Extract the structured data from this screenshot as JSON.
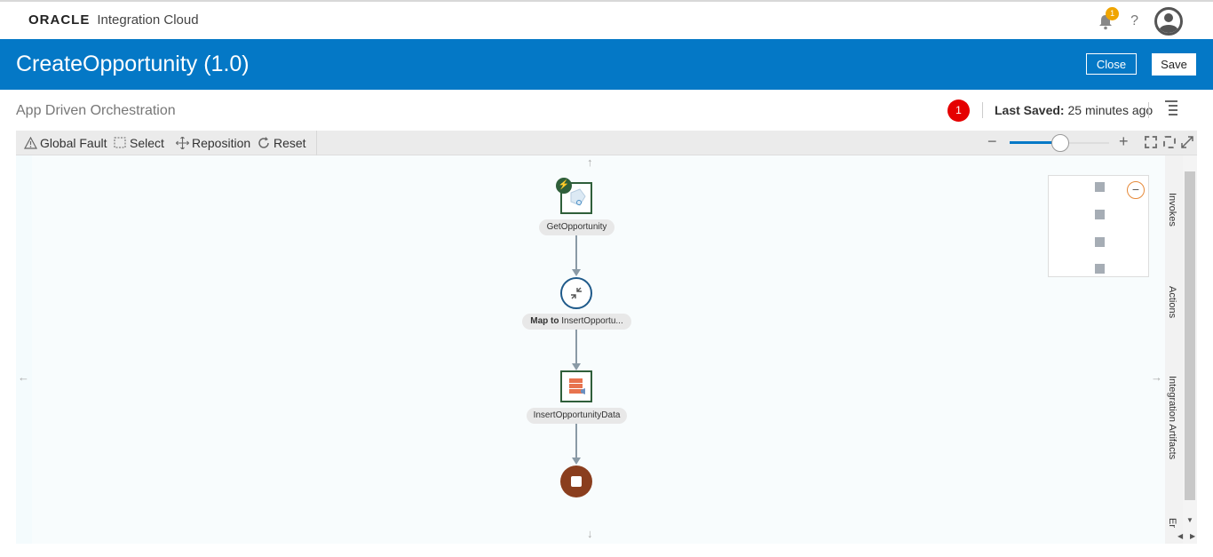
{
  "header": {
    "brand": "ORACLE",
    "product": "Integration Cloud",
    "notification_count": "1",
    "help_symbol": "?"
  },
  "titlebar": {
    "title": "CreateOpportunity (1.0)",
    "close_label": "Close",
    "save_label": "Save"
  },
  "subbar": {
    "subtitle": "App Driven Orchestration",
    "error_count": "1",
    "last_saved_label": "Last Saved:",
    "last_saved_value": "25 minutes ago"
  },
  "toolbar": {
    "global_fault": "Global Fault",
    "select": "Select",
    "reposition": "Reposition",
    "reset": "Reset",
    "zoom_level": 0.5
  },
  "flow": {
    "nodes": [
      {
        "label": "GetOpportunity",
        "type": "trigger"
      },
      {
        "label_bold": "Map to",
        "label": "InsertOpportu...",
        "type": "map"
      },
      {
        "label": "InsertOpportunityData",
        "type": "invoke"
      },
      {
        "label": "",
        "type": "end"
      }
    ]
  },
  "right_panel": {
    "tabs": [
      "Invokes",
      "Actions",
      "Integration Artifacts",
      "Er"
    ]
  },
  "colors": {
    "header_blue": "#0478c6",
    "trigger_green": "#2f5f3a",
    "end_brown": "#8a3e1e",
    "error_red": "#e50000",
    "badge_amber": "#f0a500"
  }
}
